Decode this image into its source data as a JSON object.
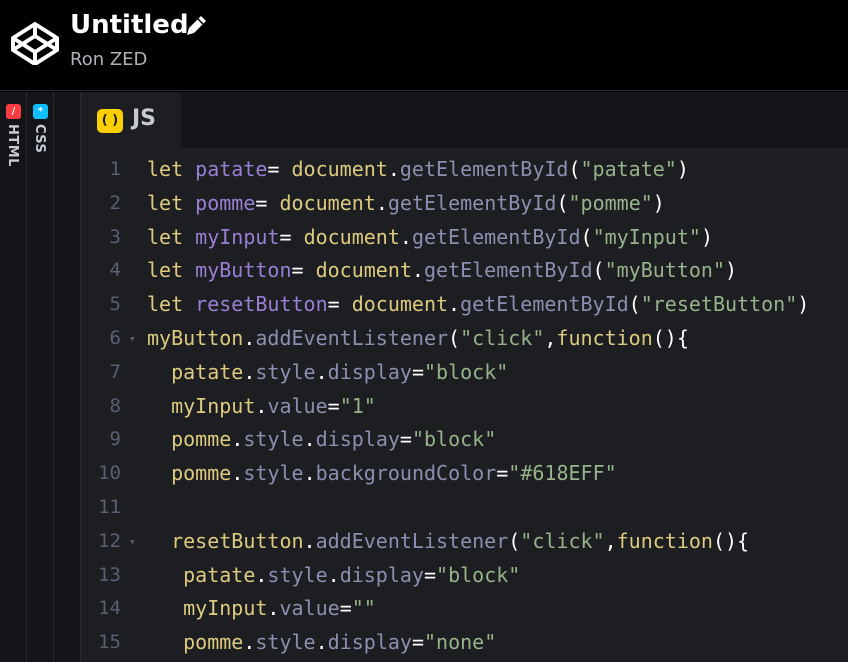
{
  "header": {
    "title": "Untitled",
    "author": "Ron ZED"
  },
  "rail": {
    "html_label": "HTML",
    "css_label": "CSS"
  },
  "editor": {
    "tab_label": "JS",
    "tab_badge": "( )",
    "lines": [
      {
        "n": "1",
        "fold": false,
        "tokens": [
          {
            "t": "let ",
            "c": "kw"
          },
          {
            "t": "patate",
            "c": "var"
          },
          {
            "t": "= ",
            "c": "pun"
          },
          {
            "t": "document",
            "c": "obj"
          },
          {
            "t": ".",
            "c": "pun"
          },
          {
            "t": "getElementById",
            "c": "prop"
          },
          {
            "t": "(",
            "c": "pun"
          },
          {
            "t": "\"patate\"",
            "c": "str"
          },
          {
            "t": ")",
            "c": "pun"
          }
        ]
      },
      {
        "n": "2",
        "fold": false,
        "tokens": [
          {
            "t": "let ",
            "c": "kw"
          },
          {
            "t": "pomme",
            "c": "var"
          },
          {
            "t": "= ",
            "c": "pun"
          },
          {
            "t": "document",
            "c": "obj"
          },
          {
            "t": ".",
            "c": "pun"
          },
          {
            "t": "getElementById",
            "c": "prop"
          },
          {
            "t": "(",
            "c": "pun"
          },
          {
            "t": "\"pomme\"",
            "c": "str"
          },
          {
            "t": ")",
            "c": "pun"
          }
        ]
      },
      {
        "n": "3",
        "fold": false,
        "tokens": [
          {
            "t": "let ",
            "c": "kw"
          },
          {
            "t": "myInput",
            "c": "var"
          },
          {
            "t": "= ",
            "c": "pun"
          },
          {
            "t": "document",
            "c": "obj"
          },
          {
            "t": ".",
            "c": "pun"
          },
          {
            "t": "getElementById",
            "c": "prop"
          },
          {
            "t": "(",
            "c": "pun"
          },
          {
            "t": "\"myInput\"",
            "c": "str"
          },
          {
            "t": ")",
            "c": "pun"
          }
        ]
      },
      {
        "n": "4",
        "fold": false,
        "tokens": [
          {
            "t": "let ",
            "c": "kw"
          },
          {
            "t": "myButton",
            "c": "var"
          },
          {
            "t": "= ",
            "c": "pun"
          },
          {
            "t": "document",
            "c": "obj"
          },
          {
            "t": ".",
            "c": "pun"
          },
          {
            "t": "getElementById",
            "c": "prop"
          },
          {
            "t": "(",
            "c": "pun"
          },
          {
            "t": "\"myButton\"",
            "c": "str"
          },
          {
            "t": ")",
            "c": "pun"
          }
        ]
      },
      {
        "n": "5",
        "fold": false,
        "tokens": [
          {
            "t": "let ",
            "c": "kw"
          },
          {
            "t": "resetButton",
            "c": "var"
          },
          {
            "t": "= ",
            "c": "pun"
          },
          {
            "t": "document",
            "c": "obj"
          },
          {
            "t": ".",
            "c": "pun"
          },
          {
            "t": "getElementById",
            "c": "prop"
          },
          {
            "t": "(",
            "c": "pun"
          },
          {
            "t": "\"resetButton\"",
            "c": "str"
          },
          {
            "t": ")",
            "c": "pun"
          }
        ]
      },
      {
        "n": "6",
        "fold": true,
        "tokens": [
          {
            "t": "myButton",
            "c": "obj"
          },
          {
            "t": ".",
            "c": "pun"
          },
          {
            "t": "addEventListener",
            "c": "prop"
          },
          {
            "t": "(",
            "c": "pun"
          },
          {
            "t": "\"click\"",
            "c": "str"
          },
          {
            "t": ",",
            "c": "pun"
          },
          {
            "t": "function",
            "c": "kw"
          },
          {
            "t": "(){",
            "c": "pun"
          }
        ]
      },
      {
        "n": "7",
        "fold": false,
        "tokens": [
          {
            "t": "  ",
            "c": "pun"
          },
          {
            "t": "patate",
            "c": "obj"
          },
          {
            "t": ".",
            "c": "pun"
          },
          {
            "t": "style",
            "c": "prop"
          },
          {
            "t": ".",
            "c": "pun"
          },
          {
            "t": "display",
            "c": "prop"
          },
          {
            "t": "=",
            "c": "pun"
          },
          {
            "t": "\"block\"",
            "c": "str"
          }
        ]
      },
      {
        "n": "8",
        "fold": false,
        "tokens": [
          {
            "t": "  ",
            "c": "pun"
          },
          {
            "t": "myInput",
            "c": "obj"
          },
          {
            "t": ".",
            "c": "pun"
          },
          {
            "t": "value",
            "c": "prop"
          },
          {
            "t": "=",
            "c": "pun"
          },
          {
            "t": "\"1\"",
            "c": "str"
          }
        ]
      },
      {
        "n": "9",
        "fold": false,
        "tokens": [
          {
            "t": "  ",
            "c": "pun"
          },
          {
            "t": "pomme",
            "c": "obj"
          },
          {
            "t": ".",
            "c": "pun"
          },
          {
            "t": "style",
            "c": "prop"
          },
          {
            "t": ".",
            "c": "pun"
          },
          {
            "t": "display",
            "c": "prop"
          },
          {
            "t": "=",
            "c": "pun"
          },
          {
            "t": "\"block\"",
            "c": "str"
          }
        ]
      },
      {
        "n": "10",
        "fold": false,
        "tokens": [
          {
            "t": "  ",
            "c": "pun"
          },
          {
            "t": "pomme",
            "c": "obj"
          },
          {
            "t": ".",
            "c": "pun"
          },
          {
            "t": "style",
            "c": "prop"
          },
          {
            "t": ".",
            "c": "pun"
          },
          {
            "t": "backgroundColor",
            "c": "prop"
          },
          {
            "t": "=",
            "c": "pun"
          },
          {
            "t": "\"#618EFF\"",
            "c": "str"
          }
        ]
      },
      {
        "n": "11",
        "fold": false,
        "tokens": []
      },
      {
        "n": "12",
        "fold": true,
        "tokens": [
          {
            "t": "  ",
            "c": "pun"
          },
          {
            "t": "resetButton",
            "c": "obj"
          },
          {
            "t": ".",
            "c": "pun"
          },
          {
            "t": "addEventListener",
            "c": "prop"
          },
          {
            "t": "(",
            "c": "pun"
          },
          {
            "t": "\"click\"",
            "c": "str"
          },
          {
            "t": ",",
            "c": "pun"
          },
          {
            "t": "function",
            "c": "kw"
          },
          {
            "t": "(){",
            "c": "pun"
          }
        ]
      },
      {
        "n": "13",
        "fold": false,
        "tokens": [
          {
            "t": "   ",
            "c": "pun"
          },
          {
            "t": "patate",
            "c": "obj"
          },
          {
            "t": ".",
            "c": "pun"
          },
          {
            "t": "style",
            "c": "prop"
          },
          {
            "t": ".",
            "c": "pun"
          },
          {
            "t": "display",
            "c": "prop"
          },
          {
            "t": "=",
            "c": "pun"
          },
          {
            "t": "\"block\"",
            "c": "str"
          }
        ]
      },
      {
        "n": "14",
        "fold": false,
        "tokens": [
          {
            "t": "   ",
            "c": "pun"
          },
          {
            "t": "myInput",
            "c": "obj"
          },
          {
            "t": ".",
            "c": "pun"
          },
          {
            "t": "value",
            "c": "prop"
          },
          {
            "t": "=",
            "c": "pun"
          },
          {
            "t": "\"\"",
            "c": "str"
          }
        ]
      },
      {
        "n": "15",
        "fold": false,
        "tokens": [
          {
            "t": "   ",
            "c": "pun"
          },
          {
            "t": "pomme",
            "c": "obj"
          },
          {
            "t": ".",
            "c": "pun"
          },
          {
            "t": "style",
            "c": "prop"
          },
          {
            "t": ".",
            "c": "pun"
          },
          {
            "t": "display",
            "c": "prop"
          },
          {
            "t": "=",
            "c": "pun"
          },
          {
            "t": "\"none\"",
            "c": "str"
          }
        ]
      }
    ]
  },
  "colors": {
    "keyword": "#ddca7e",
    "variable": "#9a7fd5",
    "property": "#8b8fb0",
    "string": "#96b38a",
    "line_number": "#5a5f73",
    "editor_bg": "#1d1e22",
    "js_badge": "#fcd000",
    "html_badge": "#ff3c41",
    "css_badge": "#0ebeff"
  },
  "icons": {
    "logo": "codepen-logo-icon",
    "edit": "pencil-icon",
    "fold": "fold-arrow-icon"
  }
}
